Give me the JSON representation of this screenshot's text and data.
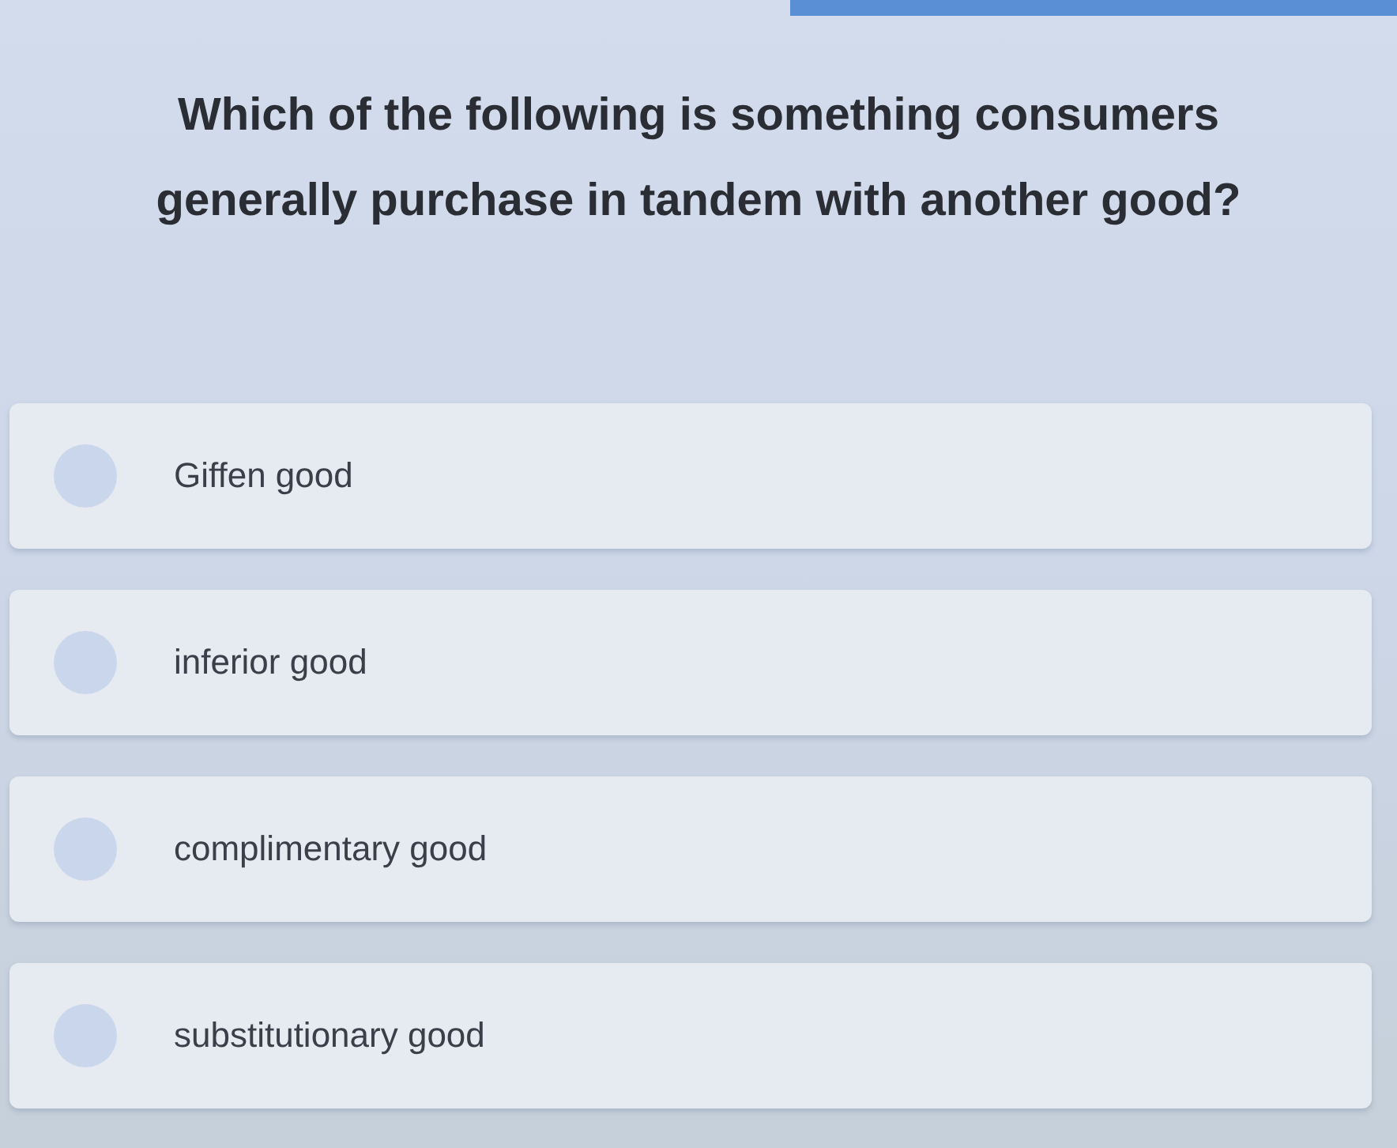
{
  "question": {
    "text": "Which of the following is something consumers generally purchase in tandem with another good?"
  },
  "options": [
    {
      "label": "Giffen good",
      "selected": false
    },
    {
      "label": "inferior good",
      "selected": false
    },
    {
      "label": "complimentary good",
      "selected": false
    },
    {
      "label": "substitutionary good",
      "selected": false
    }
  ]
}
